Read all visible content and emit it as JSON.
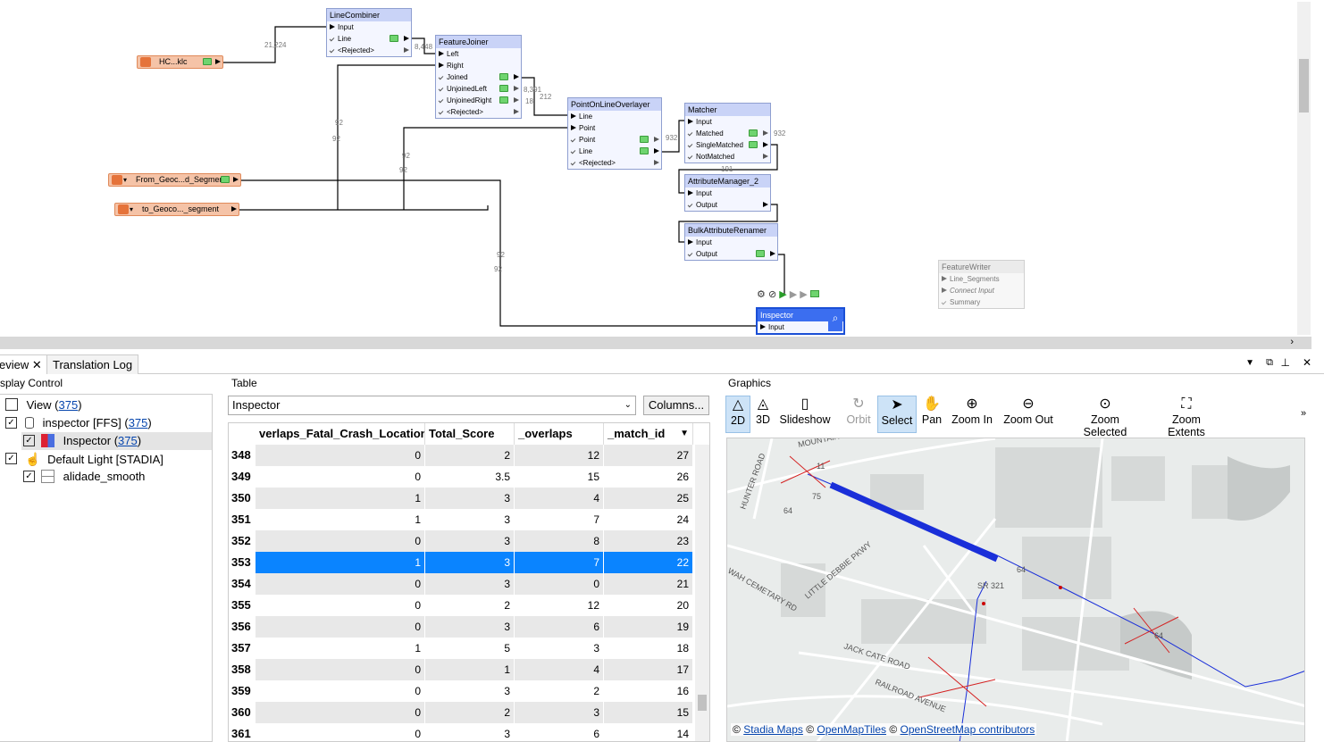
{
  "canvas": {
    "nodes": {
      "line_combiner": {
        "title": "LineCombiner",
        "ports": [
          "Input",
          "Line",
          "<Rejected>"
        ]
      },
      "feature_joiner": {
        "title": "FeatureJoiner",
        "ports": [
          "Left",
          "Right",
          "Joined",
          "UnjoinedLeft",
          "UnjoinedRight",
          "<Rejected>"
        ]
      },
      "point_on_line": {
        "title": "PointOnLineOverlayer",
        "ports": [
          "Line",
          "Point",
          "Point",
          "Line",
          "<Rejected>"
        ]
      },
      "matcher": {
        "title": "Matcher",
        "ports": [
          "Input",
          "Matched",
          "SingleMatched",
          "NotMatched"
        ]
      },
      "attr_manager": {
        "title": "AttributeManager_2",
        "ports": [
          "Input",
          "Output"
        ]
      },
      "bulk_renamer": {
        "title": "BulkAttributeRenamer",
        "ports": [
          "Input",
          "Output"
        ]
      },
      "feature_writer": {
        "title": "FeatureWriter",
        "ports": [
          "Line_Segments",
          "Connect Input",
          "Summary"
        ]
      },
      "inspector": {
        "title": "Inspector",
        "ports": [
          "Input"
        ]
      }
    },
    "readers": [
      "HC...klc",
      "From_Geoc...d_Segment",
      "to_Geoco..._segment"
    ],
    "counts": [
      "21,224",
      "8,448",
      "8,391",
      "212",
      "18",
      "932",
      "932",
      "191",
      "92",
      "92",
      "92",
      "92",
      "92",
      "92"
    ]
  },
  "tabs": {
    "view_label": "eview",
    "log_label": "Translation Log"
  },
  "display_control": {
    "title": "splay Control",
    "rows": [
      {
        "label": "View (",
        "count": "375",
        "suffix": ")"
      },
      {
        "label": "inspector [FFS] (",
        "count": "375",
        "suffix": ")"
      },
      {
        "label": "Inspector (",
        "count": "375",
        "suffix": ")"
      },
      {
        "label": "Default Light [STADIA]",
        "count": "",
        "suffix": ""
      },
      {
        "label": "alidade_smooth",
        "count": "",
        "suffix": ""
      }
    ]
  },
  "table": {
    "section_title": "Table",
    "selector_value": "Inspector",
    "columns_button": "Columns...",
    "headers": [
      "verlaps_Fatal_Crash_Location",
      "Total_Score",
      "_overlaps",
      "_match_id"
    ],
    "rows": [
      [
        "348",
        "0",
        "2",
        "12",
        "27"
      ],
      [
        "349",
        "0",
        "3.5",
        "15",
        "26"
      ],
      [
        "350",
        "1",
        "3",
        "4",
        "25"
      ],
      [
        "351",
        "1",
        "3",
        "7",
        "24"
      ],
      [
        "352",
        "0",
        "3",
        "8",
        "23"
      ],
      [
        "353",
        "1",
        "3",
        "7",
        "22"
      ],
      [
        "354",
        "0",
        "3",
        "0",
        "21"
      ],
      [
        "355",
        "0",
        "2",
        "12",
        "20"
      ],
      [
        "356",
        "0",
        "3",
        "6",
        "19"
      ],
      [
        "357",
        "1",
        "5",
        "3",
        "18"
      ],
      [
        "358",
        "0",
        "1",
        "4",
        "17"
      ],
      [
        "359",
        "0",
        "3",
        "2",
        "16"
      ],
      [
        "360",
        "0",
        "2",
        "3",
        "15"
      ],
      [
        "361",
        "0",
        "3",
        "6",
        "14"
      ]
    ],
    "selected_row": "353"
  },
  "graphics": {
    "section_title": "Graphics",
    "tools": [
      "2D",
      "3D",
      "Slideshow",
      "Orbit",
      "Select",
      "Pan",
      "Zoom In",
      "Zoom Out",
      "Zoom Selected",
      "Zoom Extents"
    ],
    "map_labels": [
      "MOUNTAIN VIEW RD",
      "HUNTER ROAD",
      "LITTLE DEBBIE PKWY",
      "WAH CEMETARY RD",
      "JACK CATE ROAD",
      "RAILROAD AVENUE",
      "SR 321",
      "11",
      "75",
      "64",
      "64",
      "64"
    ],
    "attribution": {
      "a": "Stadia Maps",
      "b": "OpenMapTiles",
      "c": "OpenStreetMap contributors",
      "sep": "©"
    }
  }
}
